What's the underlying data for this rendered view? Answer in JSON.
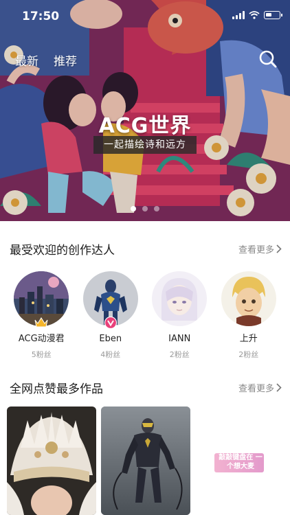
{
  "status_bar": {
    "time": "17:50"
  },
  "top_tabs": [
    {
      "label": "最新"
    },
    {
      "label": "推荐"
    }
  ],
  "banner": {
    "title": "ACG世界",
    "subtitle": "一起描绘诗和远方",
    "pages": 3,
    "active_page": 1
  },
  "creators_section": {
    "title": "最受欢迎的创作达人",
    "more_label": "查看更多",
    "creators": [
      {
        "name": "ACG动漫君",
        "fans": "5粉丝",
        "badge": "crown-icon"
      },
      {
        "name": "Eben",
        "fans": "4粉丝",
        "badge": "verified-v-icon"
      },
      {
        "name": "IANN",
        "fans": "2粉丝"
      },
      {
        "name": "上升",
        "fans": "2粉丝"
      }
    ]
  },
  "works_section": {
    "title": "全网点赞最多作品",
    "more_label": "查看更多",
    "works": [
      {
        "name": "work-1"
      },
      {
        "name": "work-2"
      },
      {
        "name": "work-3",
        "text": "敲敲键盘在 一个想大麦"
      }
    ]
  },
  "colors": {
    "accent_pink": "#e8407a",
    "crown_gold": "#f5b52a"
  }
}
